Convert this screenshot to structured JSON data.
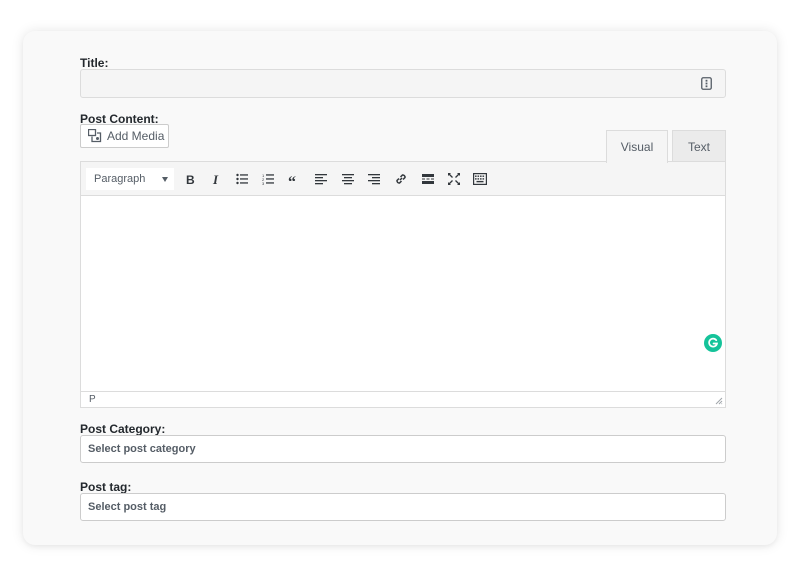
{
  "form": {
    "title_label": "Title:",
    "title_value": "",
    "content_label": "Post Content:",
    "add_media_label": "Add Media",
    "tabs": [
      {
        "label": "Visual",
        "active": true
      },
      {
        "label": "Text",
        "active": false
      }
    ],
    "editor": {
      "format_value": "Paragraph",
      "toolbar_icons": [
        "bold-icon",
        "italic-icon",
        "bulleted-list-icon",
        "numbered-list-icon",
        "blockquote-icon",
        "align-left-icon",
        "align-center-icon",
        "align-right-icon",
        "link-icon",
        "read-more-icon",
        "fullscreen-icon",
        "toolbar-toggle-icon"
      ],
      "content": "",
      "status_path": "P"
    },
    "category_label": "Post Category:",
    "category_placeholder": "Select post category",
    "tag_label": "Post tag:",
    "tag_placeholder": "Select post tag"
  },
  "colors": {
    "card_background": "#f9f9f9",
    "grammarly_green": "#15c39a",
    "border": "#dcdcdc",
    "icon": "#32373c"
  }
}
